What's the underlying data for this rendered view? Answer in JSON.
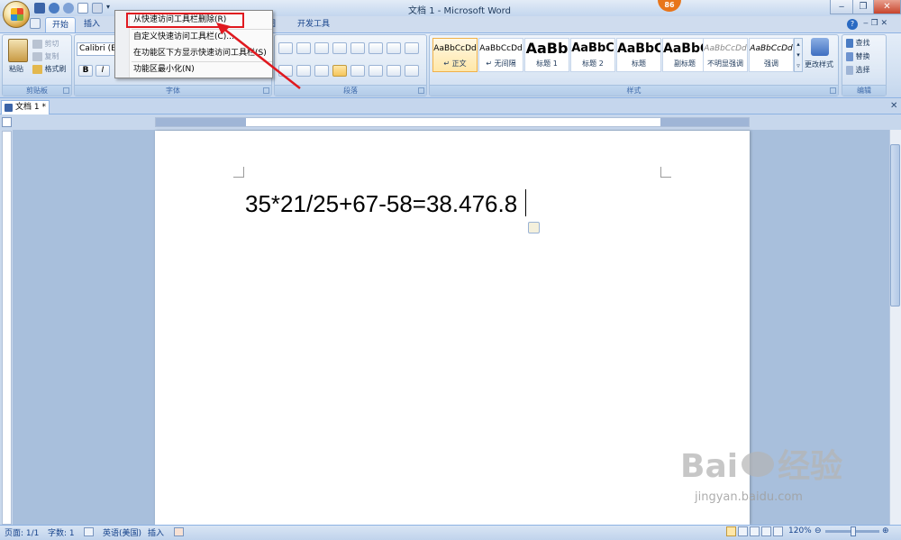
{
  "window": {
    "title": "文档 1 - Microsoft Word",
    "notification_badge": "86"
  },
  "qat_menu": {
    "items": [
      {
        "label": "从快速访问工具栏删除(R)"
      },
      {
        "label": "自定义快速访问工具栏(C)..."
      },
      {
        "label": "在功能区下方显示快速访问工具栏(S)"
      },
      {
        "label": "功能区最小化(N)"
      }
    ]
  },
  "tabs": [
    {
      "label": "开始",
      "active": true
    },
    {
      "label": "插入"
    },
    {
      "label": "图"
    },
    {
      "label": "开发工具"
    }
  ],
  "ribbon": {
    "clipboard": {
      "label": "剪贴板",
      "paste": "粘贴",
      "cut": "剪切",
      "copy": "复制",
      "format_painter": "格式刷"
    },
    "font": {
      "label": "字体",
      "font_name": "Calibri (E"
    },
    "paragraph": {
      "label": "段落"
    },
    "styles": {
      "label": "样式",
      "items": [
        {
          "preview": "AaBbCcDd",
          "name": "↵ 正文",
          "selected": true
        },
        {
          "preview": "AaBbCcDd",
          "name": "↵ 无间隔"
        },
        {
          "preview": "AaBb",
          "name": "标题 1"
        },
        {
          "preview": "AaBbC",
          "name": "标题 2"
        },
        {
          "preview": "AaBbC",
          "name": "标题"
        },
        {
          "preview": "AaBbC",
          "name": "副标题"
        },
        {
          "preview": "AaBbCcDd",
          "name": "不明显强调"
        },
        {
          "preview": "AaBbCcDd",
          "name": "强调"
        }
      ],
      "change_styles": "更改样式"
    },
    "editing": {
      "label": "编辑",
      "find": "查找",
      "replace": "替换",
      "select": "选择"
    }
  },
  "document": {
    "tab_label": "文档 1 *",
    "text": "35*21/25+67-58=38.476.8"
  },
  "status": {
    "page": "页面: 1/1",
    "words": "字数: 1",
    "language": "英语(美国)",
    "mode": "插入",
    "zoom": "120%"
  },
  "watermark": {
    "brand": "Bai",
    "brand_suffix": "经验",
    "url": "jingyan.baidu.com"
  },
  "colors": {
    "highlight_red": "#e0191f",
    "ribbon_blue": "#d3e1f2"
  }
}
